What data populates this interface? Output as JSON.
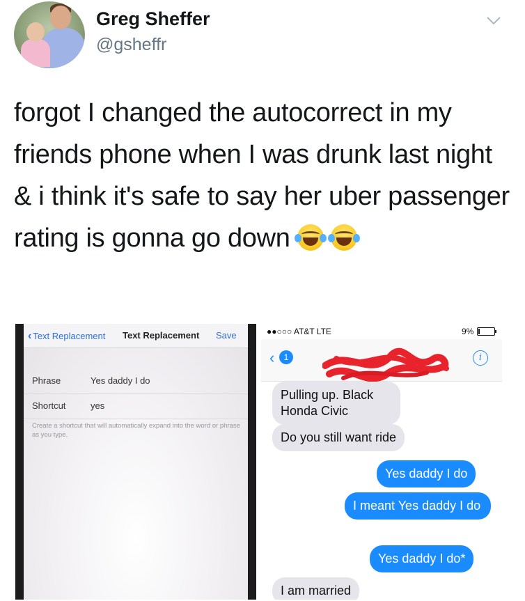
{
  "tweet": {
    "display_name": "Greg Sheffer",
    "handle": "@gsheffr",
    "text": "forgot I changed the autocorrect in my friends phone when I was drunk last night & i think it's safe to say her uber passenger rating is gonna go down",
    "emoji_name": "face-with-tears-of-joy"
  },
  "left_screenshot": {
    "nav": {
      "back_label": "Text Replacement",
      "title": "Text Replacement",
      "save_label": "Save"
    },
    "phrase_label": "Phrase",
    "phrase_value": "Yes daddy I do",
    "shortcut_label": "Shortcut",
    "shortcut_value": "yes",
    "hint": "Create a shortcut that will automatically expand into the word or phrase as you type."
  },
  "right_screenshot": {
    "status": {
      "carrier": "●●○○○ AT&T  LTE",
      "battery": "9%"
    },
    "header": {
      "unread_count": "1",
      "contact_redacted_fragment": "…92-…"
    },
    "messages": [
      {
        "side": "incoming",
        "text": "Pulling up. Black Honda Civic"
      },
      {
        "side": "incoming",
        "text": "Do you still want ride"
      },
      {
        "side": "outgoing",
        "text": "Yes daddy I do"
      },
      {
        "side": "outgoing",
        "text": "I meant Yes daddy I do"
      },
      {
        "side": "outgoing",
        "text": "Yes daddy I do*"
      },
      {
        "side": "incoming",
        "text": "I am married"
      }
    ]
  },
  "colors": {
    "imessage_blue": "#1a8cff",
    "incoming_gray": "#e6e5eb",
    "ios_link_blue": "#2f6fdc",
    "redaction_red": "#e8232c"
  }
}
